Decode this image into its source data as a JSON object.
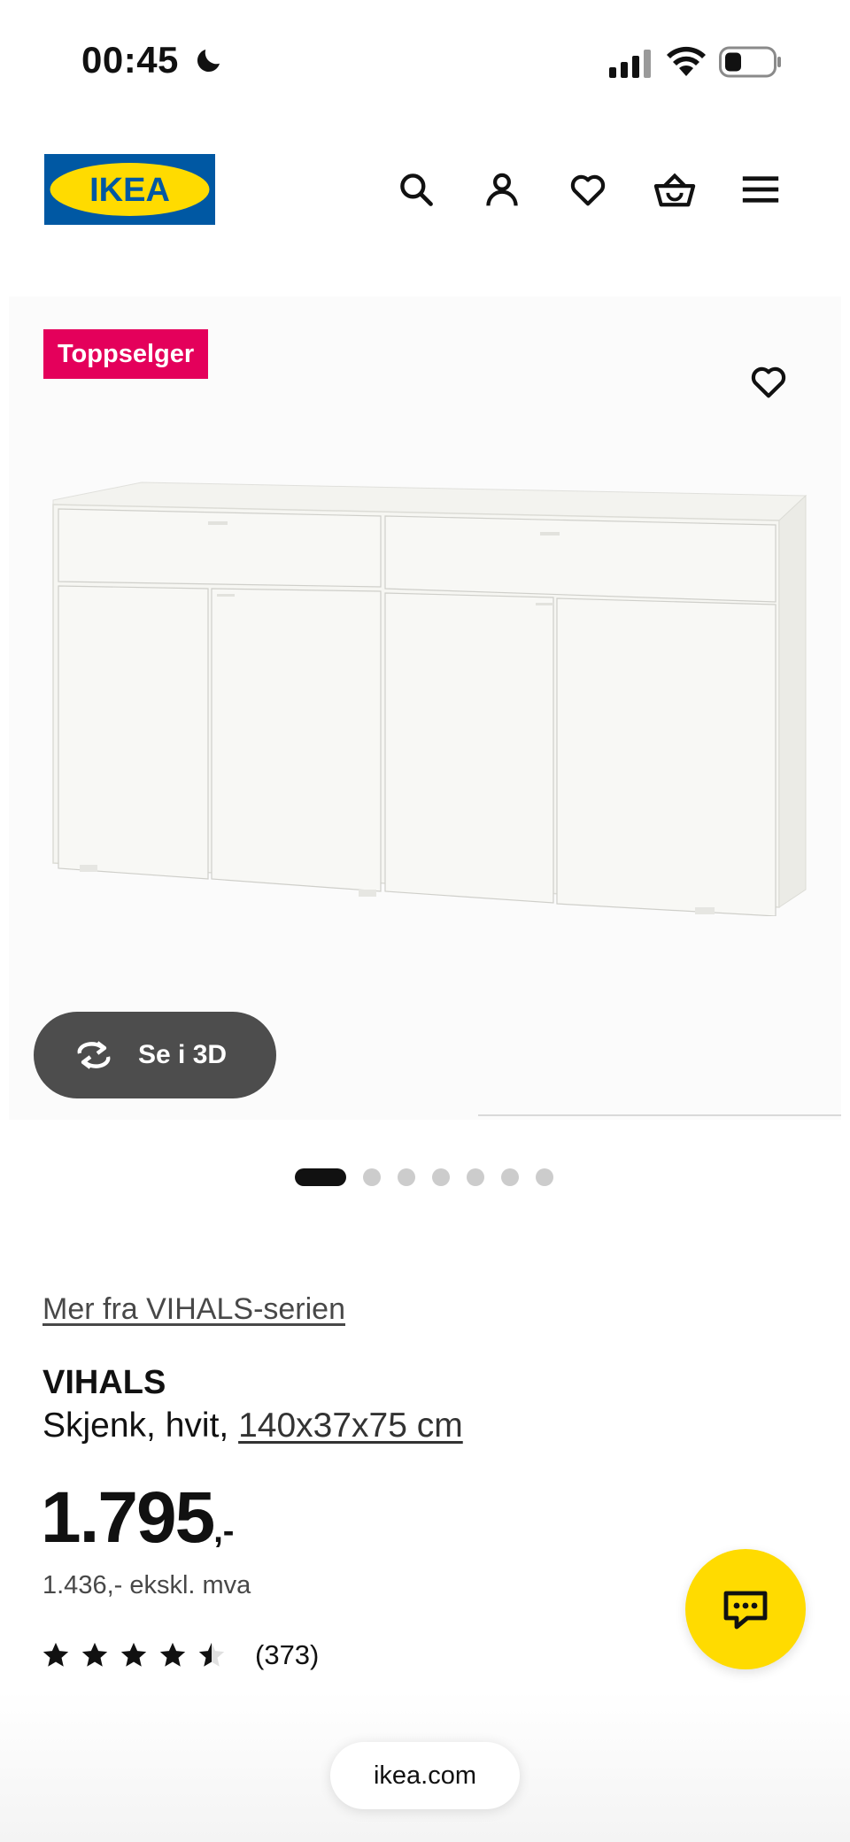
{
  "status_bar": {
    "time": "00:45"
  },
  "header": {
    "logo_text": "IKEA",
    "icons": [
      "search-icon",
      "account-icon",
      "heart-icon",
      "basket-icon",
      "menu-icon"
    ]
  },
  "gallery": {
    "badge": "Toppselger",
    "view_3d_label": "Se i 3D",
    "dot_count": 7,
    "active_dot": 0
  },
  "product": {
    "series_link": "Mer fra VIHALS-serien",
    "name": "VIHALS",
    "desc_prefix": "Skjenk, hvit, ",
    "dimensions": "140x37x75 cm",
    "price": "1.795",
    "price_suffix": ",-",
    "price_ex_vat": "1.436,- ekskl. mva",
    "rating_value": 4.5,
    "review_count": "(373)"
  },
  "browser": {
    "url": "ikea.com"
  },
  "colors": {
    "ikea_blue": "#0058a3",
    "ikea_yellow": "#ffdb00",
    "badge_red": "#e4005b",
    "button_gray": "#4d4d4d"
  }
}
